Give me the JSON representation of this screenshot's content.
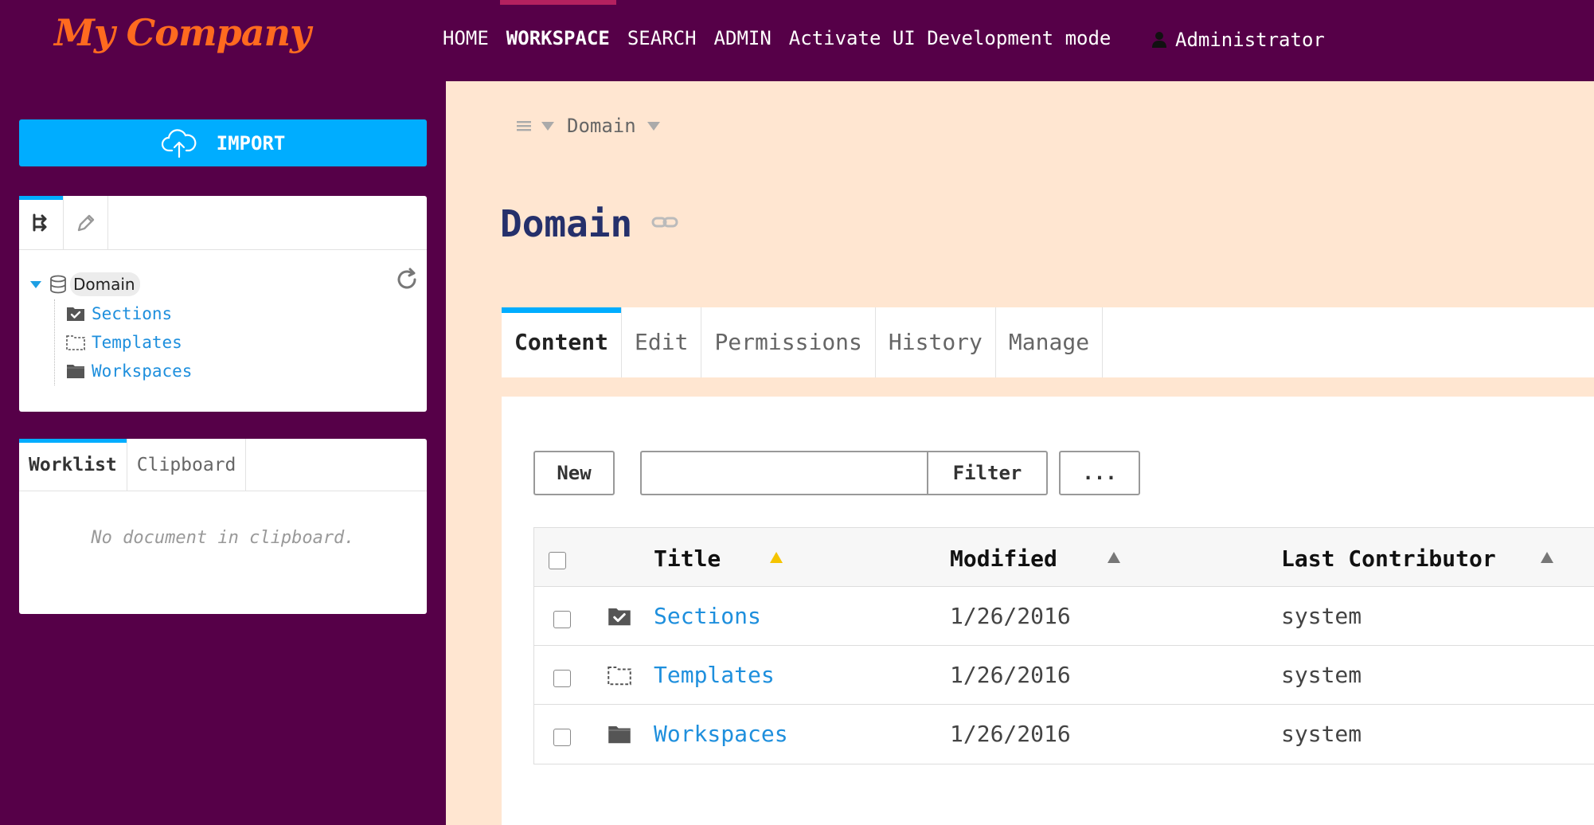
{
  "brand": {
    "logo_text": "My Company",
    "logo_color": "#ff6a1f"
  },
  "colors": {
    "header_bg": "#560048",
    "accent": "#00adff",
    "main_bg": "#ffe6d1",
    "link": "#1e8fdd",
    "title": "#25306b",
    "nav_active_bar": "#b3215f",
    "sort_active": "#f5c400"
  },
  "nav": {
    "items": [
      "HOME",
      "WORKSPACE",
      "SEARCH",
      "ADMIN",
      "Activate UI Development mode"
    ],
    "active": "WORKSPACE",
    "user": {
      "icon": "user-icon",
      "name": "Administrator"
    }
  },
  "sidebar": {
    "import_button": {
      "label": "IMPORT",
      "icon": "cloud-upload-icon"
    },
    "tree": {
      "tabs": [
        {
          "icon": "navigation-tree-icon",
          "active": true
        },
        {
          "icon": "pencil-icon",
          "active": false
        }
      ],
      "refresh_icon": "refresh-icon",
      "root": {
        "label": "Domain",
        "icon": "database-icon",
        "expanded": true
      },
      "children": [
        {
          "label": "Sections",
          "icon": "sections-folder-icon"
        },
        {
          "label": "Templates",
          "icon": "templates-folder-icon"
        },
        {
          "label": "Workspaces",
          "icon": "workspaces-folder-icon"
        }
      ]
    },
    "clipboard": {
      "tabs": [
        {
          "label": "Worklist",
          "active": true
        },
        {
          "label": "Clipboard",
          "active": false
        }
      ],
      "empty_message": "No document in clipboard."
    }
  },
  "main": {
    "breadcrumb": {
      "menu_icon": "hamburger-icon",
      "items": [
        "Domain"
      ]
    },
    "title": "Domain",
    "title_link_icon": "link-icon",
    "tabs": [
      {
        "label": "Content",
        "active": true
      },
      {
        "label": "Edit",
        "active": false
      },
      {
        "label": "Permissions",
        "active": false
      },
      {
        "label": "History",
        "active": false
      },
      {
        "label": "Manage",
        "active": false
      }
    ],
    "toolbar": {
      "new_label": "New",
      "filter_value": "",
      "filter_label": "Filter",
      "more_label": "..."
    },
    "table": {
      "columns": [
        "Title",
        "Modified",
        "Last Contributor"
      ],
      "sorted_column": "Title",
      "rows": [
        {
          "icon": "sections-folder-icon",
          "title": "Sections",
          "modified": "1/26/2016",
          "contributor": "system"
        },
        {
          "icon": "templates-folder-icon",
          "title": "Templates",
          "modified": "1/26/2016",
          "contributor": "system"
        },
        {
          "icon": "workspaces-folder-icon",
          "title": "Workspaces",
          "modified": "1/26/2016",
          "contributor": "system"
        }
      ]
    }
  }
}
